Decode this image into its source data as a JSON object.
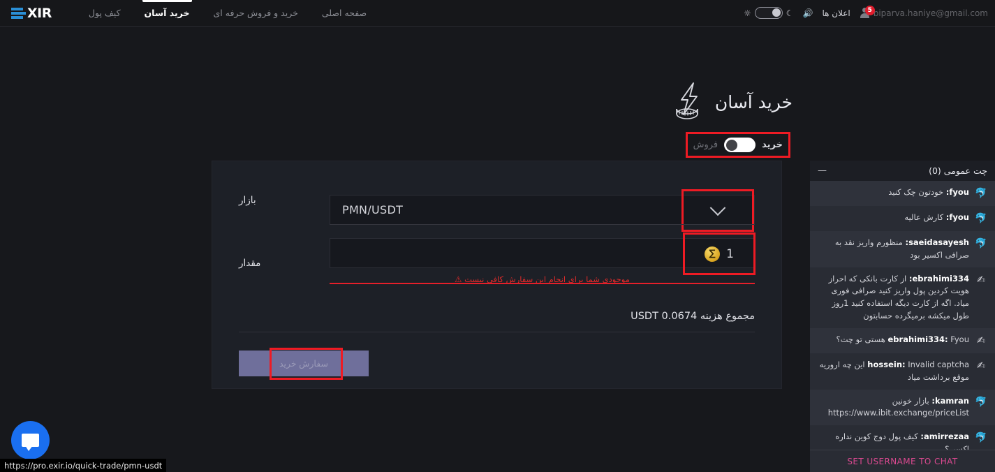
{
  "brand": {
    "name": "XIR",
    "accent": "#2a8fd6"
  },
  "topnav": {
    "tabs": [
      {
        "label": "کیف پول",
        "active": false
      },
      {
        "label": "خرید آسان",
        "active": true
      },
      {
        "label": "خرید و فروش حرفه ای",
        "active": false
      },
      {
        "label": "صفحه اصلی",
        "active": false
      }
    ],
    "theme": {
      "sun_icon": "sun-icon",
      "moon_icon": "moon-icon",
      "state": "dark"
    },
    "speaker_icon": "speaker-icon",
    "notifications_label": "اعلان ها",
    "user": {
      "email": "biparva.haniye@gmail.com",
      "badge": "5",
      "avatar_icon": "avatar-icon"
    }
  },
  "page": {
    "title": "خرید آسان",
    "title_icon": "lightning-coin-icon"
  },
  "side_toggle": {
    "buy_label": "خرید",
    "sell_label": "فروش",
    "selected": "خرید",
    "highlight_color": "#ee1b24"
  },
  "form": {
    "market": {
      "label": "بازار",
      "value": "PMN/USDT",
      "chevron_icon": "chevron-down-icon"
    },
    "amount": {
      "label": "مقدار",
      "value": "1",
      "coin_icon": "pmn-coin-icon",
      "error": "موجودی شما برای انجام این سفارش کافی نیست",
      "error_icon": "warning-icon",
      "error_color": "#e02a2a"
    },
    "total": {
      "text": "مجموع هزینه 0.0674 USDT"
    },
    "submit": {
      "label": "سفارش خرید",
      "disabled": true
    }
  },
  "chat": {
    "title": "چت عمومی (0)",
    "minimize_icon": "minimize-icon",
    "messages": [
      {
        "avatar": "dolphin-icon",
        "user": "fyou",
        "text": "خودتون چک کنید"
      },
      {
        "avatar": "dolphin-icon",
        "user": "fyou",
        "text": "کارش عالیه"
      },
      {
        "avatar": "dolphin-icon",
        "user": "saeidasayesh",
        "text": "منظورم واریز نقد به صرافی اکسیر بود"
      },
      {
        "avatar": "hand-icon",
        "user": "ebrahimi334",
        "text": "از کارت بانکی که احراز هویت کردین پول واریز کنید صرافی فوری میاد. اگه از کارت دیگه استفاده کنید 1روز طول میکشه برمیگرده حسابتون"
      },
      {
        "avatar": "hand-icon",
        "user": "ebrahimi334",
        "text": "Fyou هستی تو چت؟"
      },
      {
        "avatar": "hand-icon",
        "user": "hossein",
        "text": "Invalid captcha این چه اروریه موقع برداشت میاد"
      },
      {
        "avatar": "dolphin-icon",
        "user": "kamran",
        "text": "بازار خونین https://www.ibit.exchange/priceList"
      },
      {
        "avatar": "dolphin-icon",
        "user": "amirrezaa",
        "text": "کیف پول دوج کوین نداره اکسیر؟"
      }
    ],
    "footer_action": "SET USERNAME TO CHAT",
    "footer_color": "#d9498f"
  },
  "fab": {
    "icon": "chat-bubble-icon",
    "color": "#1a6ff0"
  },
  "status_bar": {
    "url": "https://pro.exir.io/quick-trade/pmn-usdt"
  }
}
